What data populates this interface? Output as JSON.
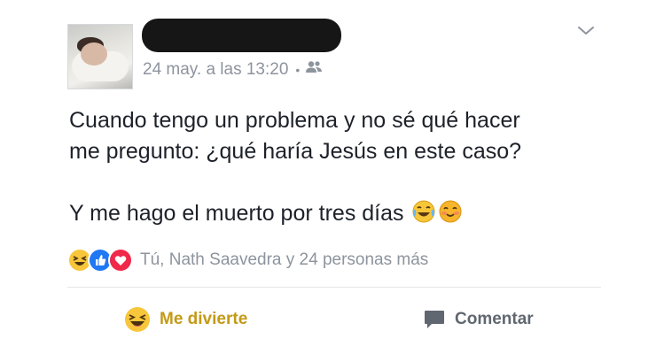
{
  "post": {
    "timestamp": "24 may. a las 13:20",
    "separator": "•",
    "audience_icon": "friends-icon",
    "menu_icon": "chevron-down-icon",
    "text_lines": [
      "Cuando tengo un problema y no sé qué hacer",
      "me pregunto: ¿qué haría Jesús en este caso?",
      "Y me hago el muerto por tres días"
    ],
    "inline_emojis": [
      "laughing-tears-emoji",
      "blushing-smile-emoji"
    ]
  },
  "reactions": {
    "icons": [
      "haha-reaction-icon",
      "like-reaction-icon",
      "love-reaction-icon"
    ],
    "summary": "Tú, Nath Saavedra y 24 personas más"
  },
  "actions": {
    "reaction_label": "Me divierte",
    "reaction_icon": "haha-icon",
    "comment_label": "Comentar",
    "comment_icon": "comment-icon"
  },
  "colors": {
    "text": "#1d2129",
    "meta": "#8d949e",
    "haha_active": "#c39a17",
    "like_blue": "#2078f4",
    "love_red": "#f0284a",
    "emoji_yellow": "#f7c63a"
  }
}
